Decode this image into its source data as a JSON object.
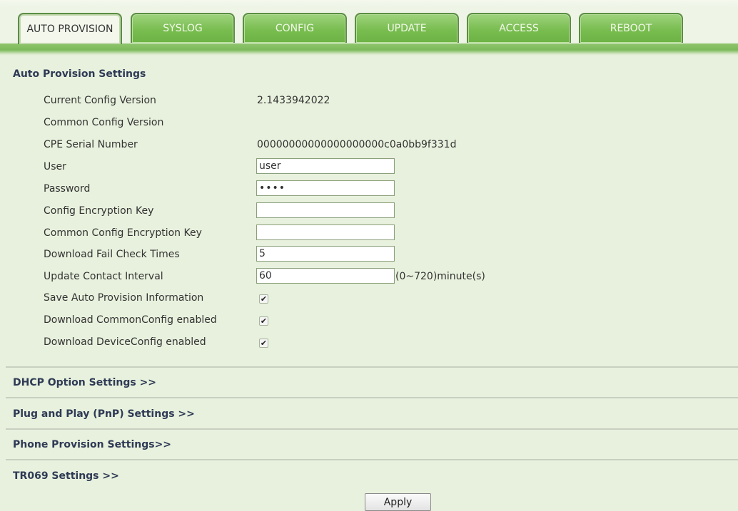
{
  "tabs": [
    {
      "label": "AUTO PROVISION",
      "active": true
    },
    {
      "label": "SYSLOG",
      "active": false
    },
    {
      "label": "CONFIG",
      "active": false
    },
    {
      "label": "UPDATE",
      "active": false
    },
    {
      "label": "ACCESS",
      "active": false
    },
    {
      "label": "REBOOT",
      "active": false
    }
  ],
  "auto_provision": {
    "title": "Auto Provision Settings",
    "current_config_version": {
      "label": "Current Config Version",
      "value": "2.1433942022"
    },
    "common_config_version": {
      "label": "Common Config Version",
      "value": ""
    },
    "cpe_serial_number": {
      "label": "CPE Serial Number",
      "value": "00000000000000000000c0a0bb9f331d"
    },
    "user": {
      "label": "User",
      "value": "user"
    },
    "password": {
      "label": "Password",
      "value": "••••"
    },
    "config_encryption_key": {
      "label": "Config Encryption Key",
      "value": ""
    },
    "common_config_encryption_key": {
      "label": "Common Config Encryption Key",
      "value": ""
    },
    "download_fail_check_times": {
      "label": "Download Fail Check Times",
      "value": "5"
    },
    "update_contact_interval": {
      "label": "Update Contact Interval",
      "value": "60",
      "unit": "(0~720)minute(s)"
    },
    "save_auto_provision_information": {
      "label": "Save Auto Provision Information",
      "checked": true
    },
    "download_commonconfig_enabled": {
      "label": "Download CommonConfig enabled",
      "checked": true
    },
    "download_deviceconfig_enabled": {
      "label": "Download DeviceConfig enabled",
      "checked": true
    }
  },
  "sections": {
    "dhcp": "DHCP Option Settings >>",
    "pnp": "Plug and Play (PnP) Settings >>",
    "phone": "Phone Provision Settings>>",
    "tr069": "TR069 Settings >>"
  },
  "apply_label": "Apply",
  "checkmark": "✔"
}
